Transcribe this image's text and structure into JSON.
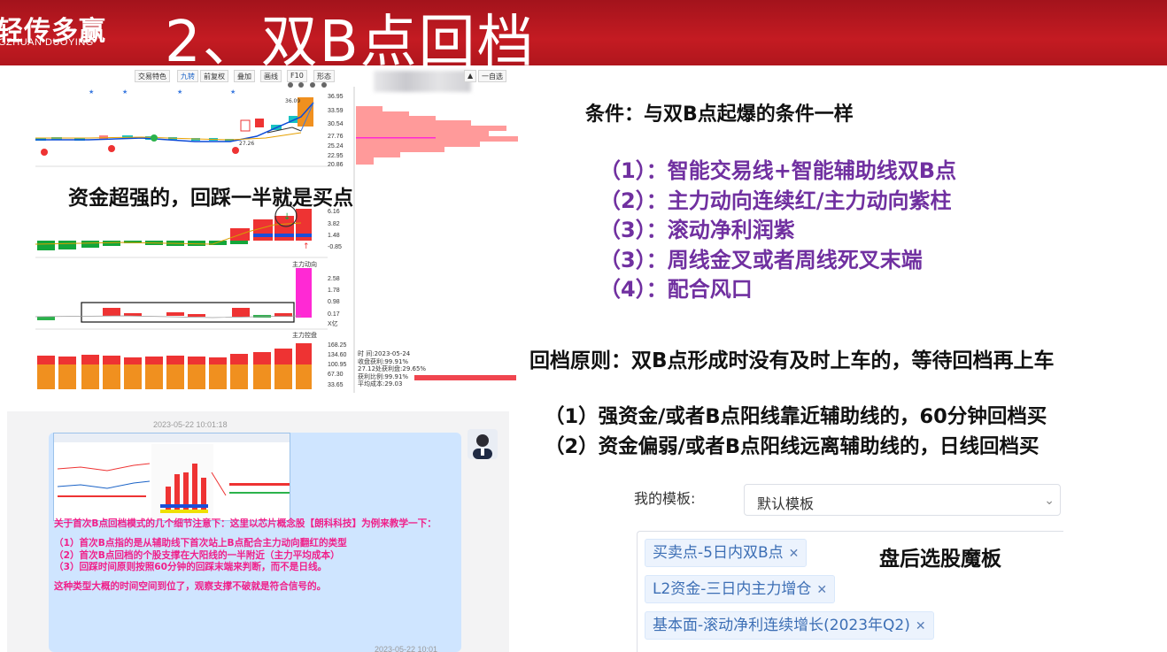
{
  "header": {
    "logo_main": "轻传多赢",
    "logo_sub": "GZHUAN DUOYING",
    "title": "2、双B点回档"
  },
  "stock_chart": {
    "toolbar": [
      "交易特色",
      "九转",
      "前复权",
      "叠加",
      "画线",
      "F10",
      "形态"
    ],
    "toolbar_right": "一自选",
    "price_axis": [
      "36.95",
      "33.59",
      "30.54",
      "27.76",
      "25.24",
      "22.95",
      "20.86"
    ],
    "price_markers": [
      "36.09",
      "27.26"
    ],
    "capital_axis": [
      "6.16",
      "3.82",
      "1.48",
      "-0.85"
    ],
    "flow_label": "主力动向",
    "flow_axis": [
      "2.58",
      "1.78",
      "0.98",
      "0.17",
      "X亿"
    ],
    "control_label": "主力控盘",
    "control_axis": [
      "168.25",
      "134.60",
      "100.95",
      "67.30",
      "33.65"
    ],
    "info": [
      "时      间:2023-05-24",
      "收盘获利:99.91%",
      "27.12处获利盘:29.65%",
      "获利比例:99.91%",
      "平均成本:29.03"
    ]
  },
  "callout": "资金超强的，回踩一半就是买点",
  "conditions": {
    "title": "条件：与双B点起爆的条件一样",
    "items": [
      "（1）：智能交易线+智能辅助线双B点",
      "（2）：主力动向连续红/主力动向紫柱",
      "（3）：滚动净利润紫",
      "（3）：周线金叉或者周线死叉末端",
      "（4）：配合风口"
    ],
    "color": "#7030a0"
  },
  "principle": "回档原则：双B点形成时没有及时上车的，等待回档再上车",
  "rules": [
    "（1）强资金/或者B点阳线靠近辅助线的，60分钟回档买",
    "（2）资金偏弱/或者B点阳线远离辅助线的，日线回档买"
  ],
  "chat": {
    "timestamp": "2023-05-22 10:01:18",
    "timestamp_bottom": "2023-05-22 10:01",
    "lines": [
      "关于首次B点回档模式的几个细节注意下：这里以芯片概念股【朗科科技】为例来教学一下：",
      "",
      "（1）首次B点指的是从辅助线下首次站上B点配合主力动向翻红的类型",
      "（2）首次B点回档的个股支撑在大阳线的一半附近（主力平均成本）",
      "（3）回踩时间原则按照60分钟的回踩末端来判断，而不是日线。",
      "",
      "这种类型大概的时间空间到位了，观察支撑不破就是符合信号的。"
    ],
    "text_color": "#f0208a"
  },
  "template": {
    "label": "我的模板:",
    "selected": "默认模板",
    "tags": [
      "买卖点-5日内双B点",
      "L2资金-三日内主力增仓",
      "基本面-滚动净利连续增长(2023年Q2)"
    ],
    "caption": "盘后选股魔板"
  }
}
